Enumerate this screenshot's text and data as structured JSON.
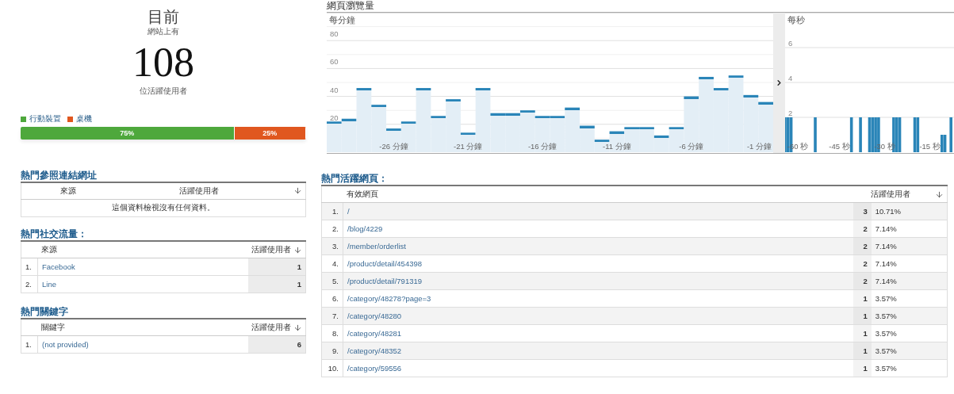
{
  "summary": {
    "title": "目前",
    "subtitle": "網站上有",
    "count": "108",
    "caption": "位活躍使用者"
  },
  "devices": {
    "legend": [
      {
        "label": "行動裝置",
        "color": "#4ea83c"
      },
      {
        "label": "桌機",
        "color": "#e0571f"
      }
    ],
    "segments": [
      {
        "label": "75%",
        "level": 0.75,
        "color": "#4ea83c"
      },
      {
        "label": "25%",
        "level": 0.25,
        "color": "#e0571f"
      }
    ]
  },
  "pageviews": {
    "title": "網頁瀏覽量",
    "minute_chart": {
      "chart_data": {
        "type": "bar",
        "grid": true,
        "title": "每分鐘",
        "categories": [
          null,
          null,
          null,
          null,
          "-26 分鐘",
          null,
          null,
          null,
          null,
          "-21 分鐘",
          null,
          null,
          null,
          null,
          "-16 分鐘",
          null,
          null,
          null,
          null,
          "-11 分鐘",
          null,
          null,
          null,
          null,
          "-6 分鐘",
          null,
          null,
          null,
          null,
          "-1 分鐘"
        ],
        "values": [
          22,
          24,
          46,
          34,
          17,
          22,
          46,
          26,
          38,
          14,
          46,
          28,
          28,
          30,
          26,
          26,
          32,
          19,
          9,
          15,
          18,
          18,
          12,
          18,
          40,
          54,
          46,
          55,
          41,
          36
        ],
        "ylim": [
          0,
          100
        ],
        "yticks": [
          20,
          40,
          60,
          80
        ]
      }
    },
    "second_chart": {
      "chart_data": {
        "type": "bar",
        "title": "每秒",
        "x": [
          -63,
          -62,
          -61,
          -53,
          -41,
          -38,
          -35,
          -34,
          -33,
          -32,
          -27,
          -26,
          -25,
          -20,
          -19,
          -11,
          -10,
          -8
        ],
        "values": [
          2,
          2,
          2,
          2,
          2,
          2,
          2,
          2,
          2,
          2,
          2,
          2,
          2,
          2,
          2,
          1,
          1,
          2
        ],
        "xlim": [
          -63,
          -7
        ],
        "ylim": [
          0,
          8
        ],
        "grid": true,
        "yticks": [
          2,
          4,
          6
        ],
        "xticks": [
          {
            "value": -60,
            "label": "-60 秒"
          },
          {
            "value": -45,
            "label": "-45 秒"
          },
          {
            "value": -30,
            "label": "-30 秒"
          },
          {
            "value": -15,
            "label": "-15 秒"
          }
        ]
      }
    }
  },
  "referrers": {
    "title": "熱門參照連結網址",
    "columns": [
      "來源",
      "活躍使用者"
    ],
    "empty": "這個資料檢視沒有任何資料。"
  },
  "social": {
    "title": "熱門社交流量：",
    "columns": [
      "來源",
      "活躍使用者"
    ],
    "rows": [
      {
        "rank": "1.",
        "name": "Facebook",
        "users": "1"
      },
      {
        "rank": "2.",
        "name": "Line",
        "users": "1"
      }
    ]
  },
  "keywords": {
    "title": "熱門關鍵字",
    "columns": [
      "關鍵字",
      "活躍使用者"
    ],
    "rows": [
      {
        "rank": "1.",
        "name": "(not provided)",
        "users": "6"
      }
    ]
  },
  "pages": {
    "title": "熱門活躍網頁：",
    "columns": [
      "有效網頁",
      "活躍使用者"
    ],
    "rows": [
      {
        "rank": "1.",
        "page": "/",
        "users": "3",
        "share": "10.71%"
      },
      {
        "rank": "2.",
        "page": "/blog/4229",
        "users": "2",
        "share": "7.14%"
      },
      {
        "rank": "3.",
        "page": "/member/orderlist",
        "users": "2",
        "share": "7.14%"
      },
      {
        "rank": "4.",
        "page": "/product/detail/454398",
        "users": "2",
        "share": "7.14%"
      },
      {
        "rank": "5.",
        "page": "/product/detail/791319",
        "users": "2",
        "share": "7.14%"
      },
      {
        "rank": "6.",
        "page": "/category/48278?page=3",
        "users": "1",
        "share": "3.57%"
      },
      {
        "rank": "7.",
        "page": "/category/48280",
        "users": "1",
        "share": "3.57%"
      },
      {
        "rank": "8.",
        "page": "/category/48281",
        "users": "1",
        "share": "3.57%"
      },
      {
        "rank": "9.",
        "page": "/category/48352",
        "users": "1",
        "share": "3.57%"
      },
      {
        "rank": "10.",
        "page": "/category/59556",
        "users": "1",
        "share": "3.57%"
      }
    ]
  }
}
